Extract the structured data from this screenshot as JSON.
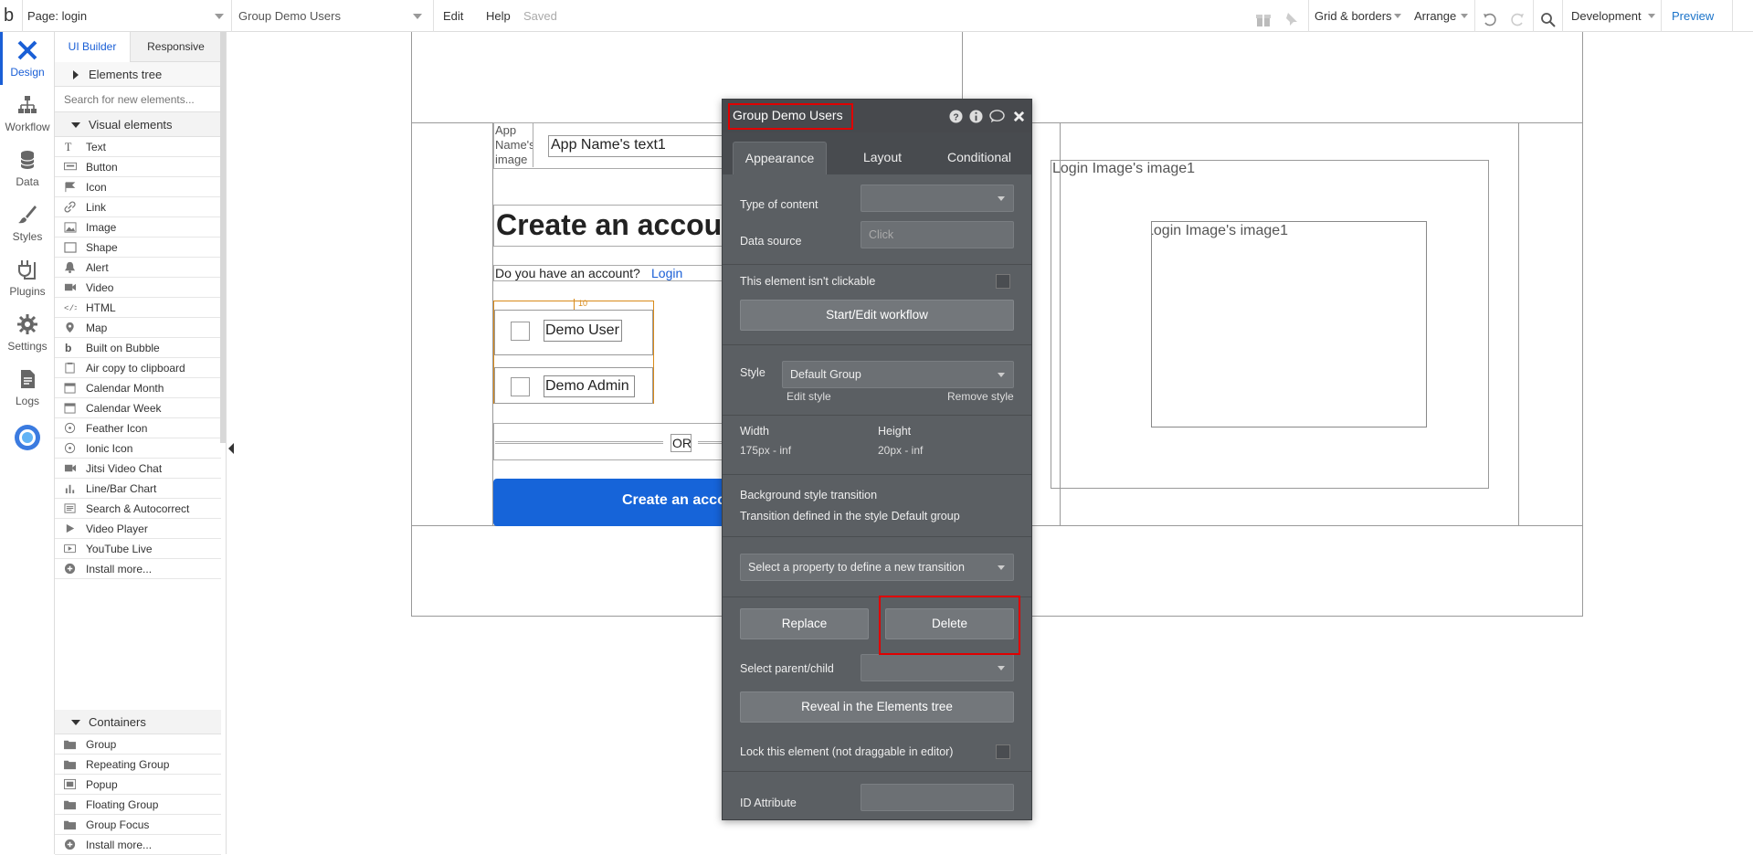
{
  "topbar": {
    "logo": "b",
    "page_label": "Page: login",
    "element_selector": "Group Demo Users",
    "menu": [
      "Edit",
      "Help"
    ],
    "saved_label": "Saved",
    "grid_label": "Grid & borders",
    "arrange_label": "Arrange",
    "environment_label": "Development",
    "preview_label": "Preview"
  },
  "rail": [
    {
      "label": "Design",
      "icon": "design-icon"
    },
    {
      "label": "Workflow",
      "icon": "workflow-icon"
    },
    {
      "label": "Data",
      "icon": "database-icon"
    },
    {
      "label": "Styles",
      "icon": "brush-icon"
    },
    {
      "label": "Plugins",
      "icon": "plug-icon"
    },
    {
      "label": "Settings",
      "icon": "gear-icon"
    },
    {
      "label": "Logs",
      "icon": "document-icon"
    }
  ],
  "panel": {
    "tabs": [
      "UI Builder",
      "Responsive"
    ],
    "elements_tree": "Elements tree",
    "search_placeholder": "Search for new elements...",
    "visual_header": "Visual elements",
    "visual_items": [
      "Text",
      "Button",
      "Icon",
      "Link",
      "Image",
      "Shape",
      "Alert",
      "Video",
      "HTML",
      "Map",
      "Built on Bubble",
      "Air copy to clipboard",
      "Calendar Month",
      "Calendar Week",
      "Feather Icon",
      "Ionic Icon",
      "Jitsi Video Chat",
      "Line/Bar Chart",
      "Search & Autocorrect",
      "Video Player",
      "YouTube Live",
      "Install more..."
    ],
    "containers_header": "Containers",
    "container_items": [
      "Group",
      "Repeating Group",
      "Popup",
      "Floating Group",
      "Group Focus",
      "Install more..."
    ]
  },
  "canvas": {
    "app_image_text": "App Name's image",
    "app_name_text": "App Name's text1",
    "heading": "Create an account",
    "have_account_text": "Do you have an account?",
    "login_link": "Login",
    "group_label": "10",
    "demo_user": "Demo User",
    "demo_admin": "Demo Admin",
    "or_text": "OR",
    "create_button": "Create an account",
    "login_image_label": "Login Image's image1",
    "inner_image_label": "Login Image's image1"
  },
  "prop": {
    "title": "Group Demo Users",
    "tabs": [
      "Appearance",
      "Layout",
      "Conditional"
    ],
    "type_of_content_label": "Type of content",
    "type_of_content_value": "",
    "data_source_label": "Data source",
    "data_source_placeholder": "Click",
    "not_clickable_label": "This element isn't clickable",
    "workflow_button": "Start/Edit workflow",
    "style_label": "Style",
    "style_value": "Default Group",
    "edit_style": "Edit style",
    "remove_style": "Remove style",
    "width_label": "Width",
    "width_value": "175px - inf",
    "height_label": "Height",
    "height_value": "20px - inf",
    "bg_transition_label": "Background style transition",
    "transition_note": "Transition defined in the style Default group",
    "transition_select": "Select a property to define a new transition",
    "replace_button": "Replace",
    "delete_button": "Delete",
    "parent_child_label": "Select parent/child",
    "reveal_button": "Reveal in the Elements tree",
    "lock_label": "Lock this element (not draggable in editor)",
    "id_attribute_label": "ID Attribute"
  }
}
